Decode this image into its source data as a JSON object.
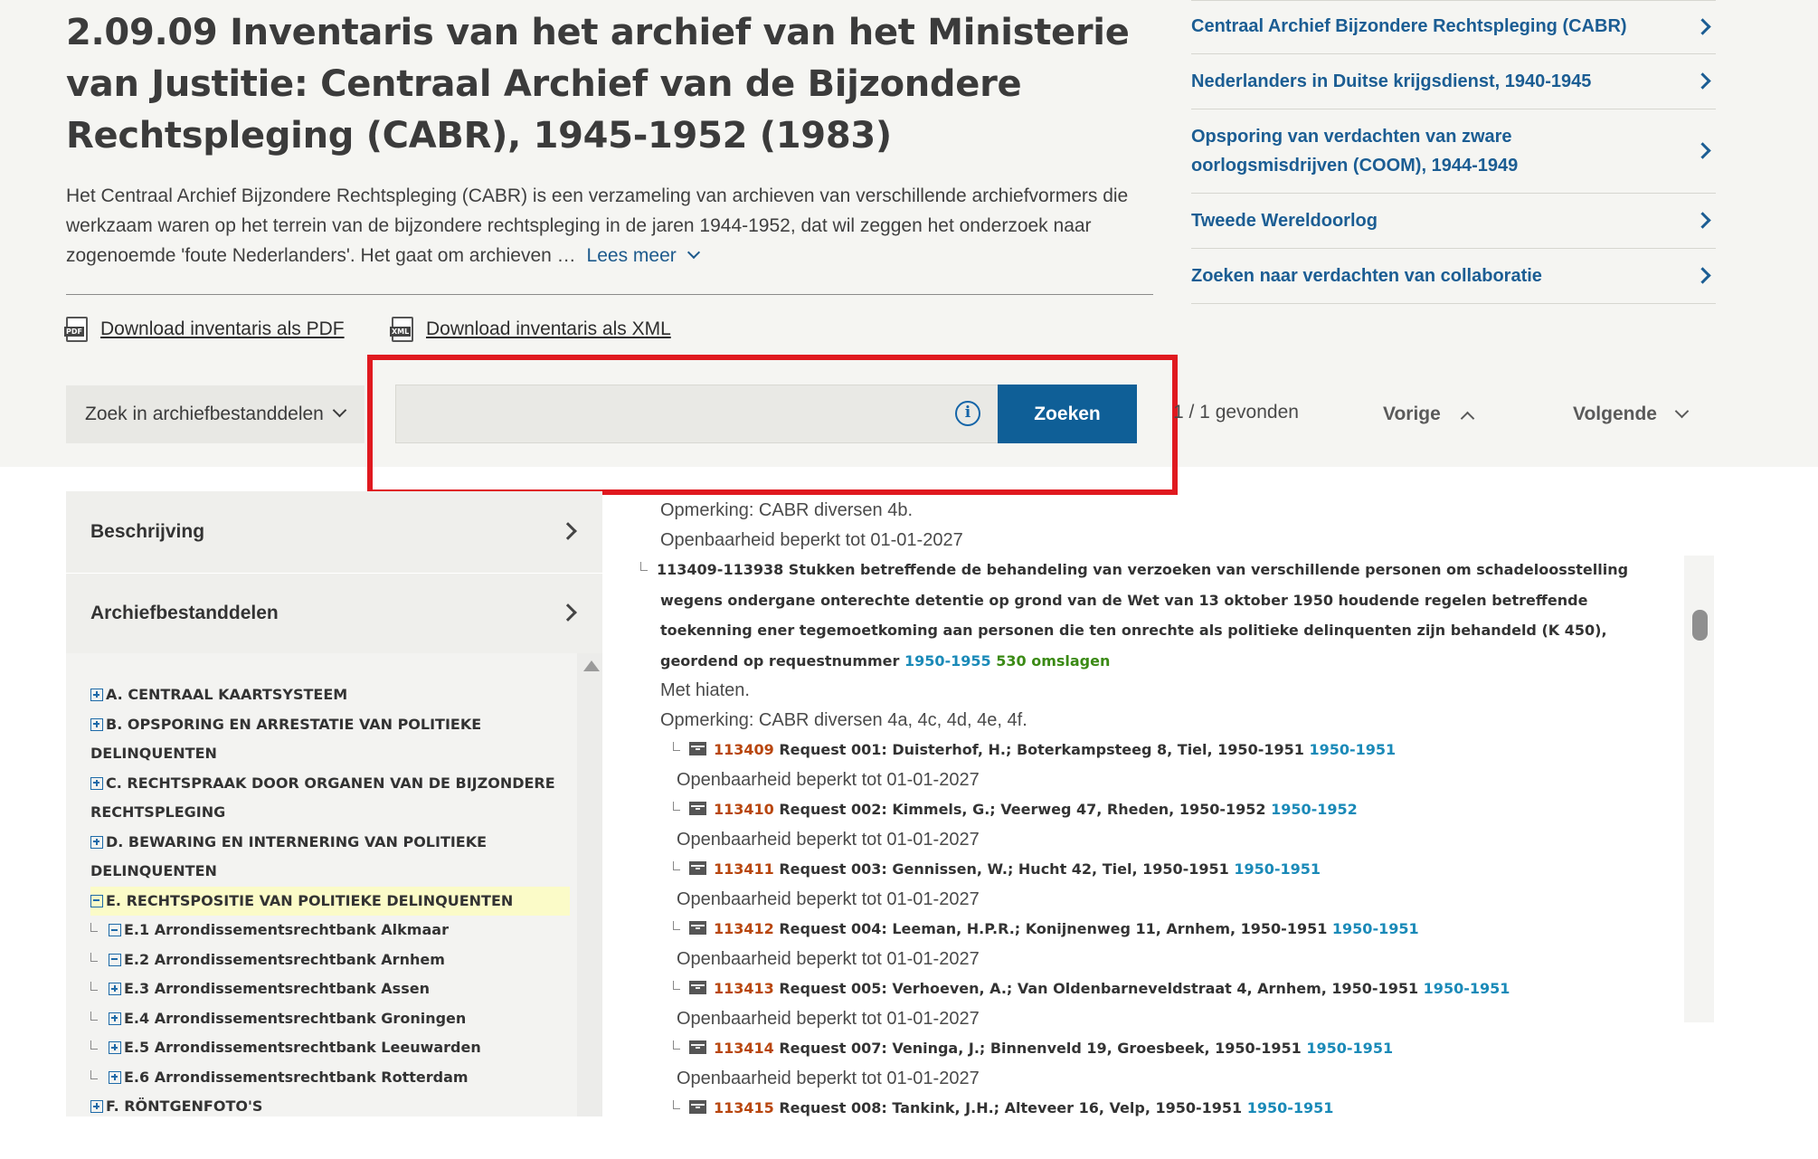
{
  "page": {
    "title": "2.09.09 Inventaris van het archief van het Ministerie van Justitie: Centraal Archief van de Bijzondere Rechtspleging (CABR), 1945-1952 (1983)",
    "intro": "Het Centraal Archief Bijzondere Rechtspleging (CABR) is een verzameling van archieven van verschillende archiefvormers die werkzaam waren op het terrein van de bijzondere rechtspleging in de jaren 1944-1952, dat wil zeggen het onderzoek naar zogenoemde 'foute Nederlanders'. Het gaat om archieven …",
    "read_more": "Lees meer"
  },
  "downloads": [
    {
      "icon": "pdf-file-icon",
      "badge": "PDF",
      "label": "Download inventaris als PDF"
    },
    {
      "icon": "xml-file-icon",
      "badge": "XML",
      "label": "Download inventaris als XML"
    }
  ],
  "search": {
    "scope_label": "Zoek in archiefbestanddelen",
    "query": "",
    "button": "Zoeken",
    "found": "1 / 1 gevonden",
    "prev": "Vorige",
    "next": "Volgende"
  },
  "related_links": [
    "Centraal Archief Bijzondere Rechtspleging (CABR)",
    "Nederlanders in Duitse krijgsdienst, 1940-1945",
    "Opsporing van verdachten van zware oorlogsmisdrijven (COOM), 1944-1949",
    "Tweede Wereldoorlog",
    "Zoeken naar verdachten van collaboratie"
  ],
  "panel": {
    "description": "Beschrijving",
    "components": "Archiefbestanddelen"
  },
  "tree": [
    {
      "label": "A. CENTRAAL KAARTSYSTEEM",
      "state": "collapsed",
      "level": 0
    },
    {
      "label": "B. OPSPORING EN ARRESTATIE VAN POLITIEKE DELINQUENTEN",
      "state": "collapsed",
      "level": 0
    },
    {
      "label": "C. RECHTSPRAAK DOOR ORGANEN VAN DE BIJZONDERE RECHTSPLEGING",
      "state": "collapsed",
      "level": 0
    },
    {
      "label": "D. BEWARING EN INTERNERING VAN POLITIEKE DELINQUENTEN",
      "state": "collapsed",
      "level": 0
    },
    {
      "label": "E. RECHTSPOSITIE VAN POLITIEKE DELINQUENTEN",
      "state": "expanded",
      "level": 0,
      "selected": true
    },
    {
      "label": "E.1 Arrondissementsrechtbank Alkmaar",
      "state": "expanded",
      "level": 1
    },
    {
      "label": "E.2 Arrondissementsrechtbank Arnhem",
      "state": "expanded",
      "level": 1
    },
    {
      "label": "E.3 Arrondissementsrechtbank Assen",
      "state": "collapsed",
      "level": 1
    },
    {
      "label": "E.4 Arrondissementsrechtbank Groningen",
      "state": "collapsed",
      "level": 1
    },
    {
      "label": "E.5 Arrondissementsrechtbank Leeuwarden",
      "state": "collapsed",
      "level": 1
    },
    {
      "label": "E.6 Arrondissementsrechtbank Rotterdam",
      "state": "collapsed",
      "level": 1
    },
    {
      "label": "F. RÖNTGENFOTO'S",
      "state": "collapsed",
      "level": 0
    }
  ],
  "content": {
    "remark_top": "Opmerking: CABR diversen 4b.",
    "access_top": "Openbaarheid beperkt tot 01-01-2027",
    "group": {
      "text": "113409-113938 Stukken betreffende de behandeling van verzoeken van verschillende personen om schadeloosstelling wegens ondergane onterechte detentie op grond van de Wet van 13 oktober 1950 houdende regelen betreffende toekenning ener tegemoetkoming aan personen die ten onrechte als politieke delinquenten zijn behandeld (K 450), geordend op requestnummer",
      "years": "1950-1955",
      "count": "530 omslagen",
      "note": "Met hiaten.",
      "remark": "Opmerking: CABR diversen 4a, 4c, 4d, 4e, 4f."
    },
    "items": [
      {
        "num": "113409",
        "desc": "Request 001: Duisterhof, H.; Boterkampsteeg 8, Tiel, 1950-1951",
        "years": "1950-1951",
        "access": "Openbaarheid beperkt tot 01-01-2027"
      },
      {
        "num": "113410",
        "desc": "Request 002: Kimmels, G.; Veerweg 47, Rheden, 1950-1952",
        "years": "1950-1952",
        "access": "Openbaarheid beperkt tot 01-01-2027"
      },
      {
        "num": "113411",
        "desc": "Request 003: Gennissen, W.; Hucht 42, Tiel, 1950-1951",
        "years": "1950-1951",
        "access": "Openbaarheid beperkt tot 01-01-2027"
      },
      {
        "num": "113412",
        "desc": "Request 004: Leeman, H.P.R.; Konijnenweg 11, Arnhem, 1950-1951",
        "years": "1950-1951",
        "access": "Openbaarheid beperkt tot 01-01-2027"
      },
      {
        "num": "113413",
        "desc": "Request 005: Verhoeven, A.; Van Oldenbarneveldstraat 4, Arnhem, 1950-1951",
        "years": "1950-1951",
        "access": "Openbaarheid beperkt tot 01-01-2027"
      },
      {
        "num": "113414",
        "desc": "Request 007: Veninga, J.; Binnenveld 19, Groesbeek, 1950-1951",
        "years": "1950-1951",
        "access": "Openbaarheid beperkt tot 01-01-2027"
      },
      {
        "num": "113415",
        "desc": "Request 008: Tankink, J.H.; Alteveer 16, Velp, 1950-1951",
        "years": "1950-1951",
        "access": ""
      }
    ]
  },
  "colors": {
    "accent": "#0f5f97",
    "link": "#1b5d93",
    "highlight_frame": "#e0191f",
    "inventory_number": "#b8460e",
    "year_link": "#1a8ab8",
    "count": "#3b8a15"
  }
}
